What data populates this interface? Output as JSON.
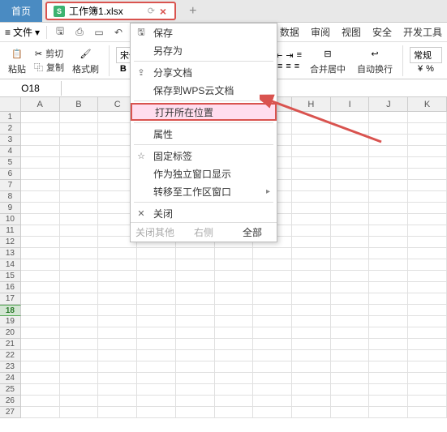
{
  "tabs": {
    "home": "首页",
    "file_name": "工作簿1.xlsx",
    "file_badge": "S"
  },
  "toolbar": {
    "file_label": "文件"
  },
  "menubar": [
    "数据",
    "审阅",
    "视图",
    "安全",
    "开发工具"
  ],
  "ribbon": {
    "cut": "剪切",
    "copy": "复制",
    "paste": "粘贴",
    "format_brush": "格式刷",
    "font_name": "宋体",
    "merge_center": "合并居中",
    "auto_wrap": "自动换行",
    "style_format": "常规"
  },
  "cellref": "O18",
  "columns": [
    "A",
    "B",
    "C",
    "D",
    "E",
    "F",
    "G",
    "H",
    "I",
    "J",
    "K"
  ],
  "row_count": 27,
  "active_row": 18,
  "context_menu": {
    "save": "保存",
    "save_as": "另存为",
    "share_doc": "分享文档",
    "save_to_cloud": "保存到WPS云文档",
    "open_location": "打开所在位置",
    "properties": "属性",
    "pin_tab": "固定标签",
    "open_standalone": "作为独立窗口显示",
    "move_to_workspace": "转移至工作区窗口",
    "close": "关闭",
    "footer": {
      "close_others": "关闭其他",
      "close_right": "右侧",
      "close_all": "全部"
    }
  }
}
